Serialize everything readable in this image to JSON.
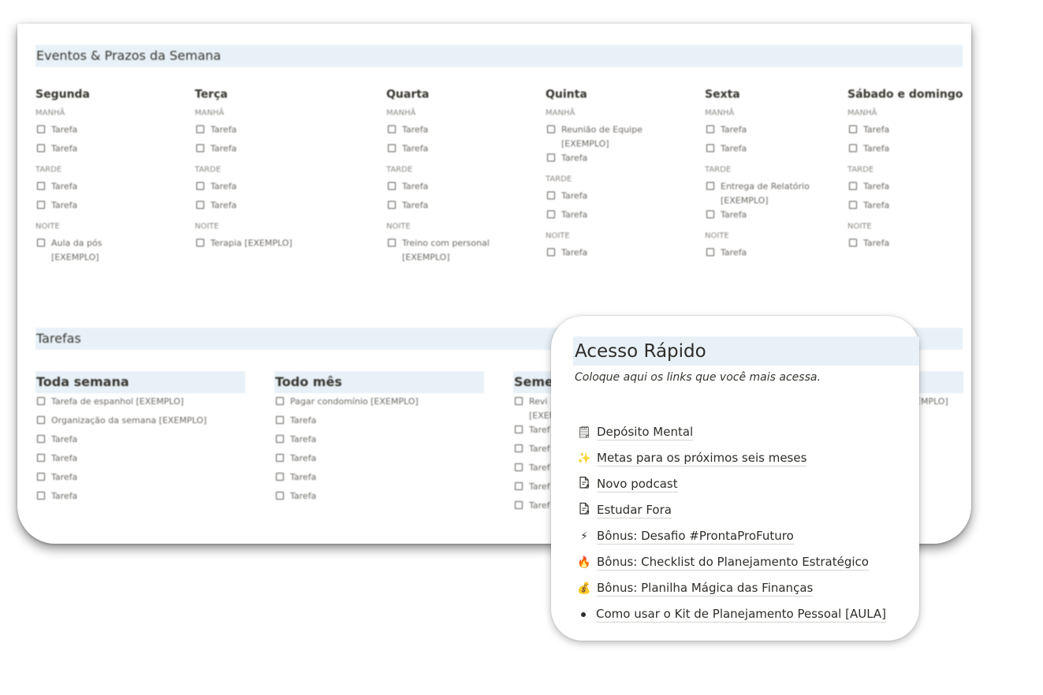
{
  "events": {
    "title": "Eventos & Prazos da Semana",
    "days": [
      {
        "name": "Segunda",
        "periods": [
          {
            "label": "MANHÃ",
            "tasks": [
              "Tarefa",
              "Tarefa"
            ]
          },
          {
            "label": "TARDE",
            "tasks": [
              "Tarefa",
              "Tarefa"
            ]
          },
          {
            "label": "NOITE",
            "tasks": [
              "Aula da pós [EXEMPLO]"
            ]
          }
        ]
      },
      {
        "name": "Terça",
        "periods": [
          {
            "label": "MANHÃ",
            "tasks": [
              "Tarefa",
              "Tarefa"
            ]
          },
          {
            "label": "TARDE",
            "tasks": [
              "Tarefa",
              "Tarefa"
            ]
          },
          {
            "label": "NOITE",
            "tasks": [
              "Terapia [EXEMPLO]"
            ]
          }
        ]
      },
      {
        "name": "Quarta",
        "periods": [
          {
            "label": "MANHÃ",
            "tasks": [
              "Tarefa",
              "Tarefa"
            ]
          },
          {
            "label": "TARDE",
            "tasks": [
              "Tarefa",
              "Tarefa"
            ]
          },
          {
            "label": "NOITE",
            "tasks": [
              "Treino com personal [EXEMPLO]"
            ]
          }
        ]
      },
      {
        "name": "Quinta",
        "periods": [
          {
            "label": "MANHÃ",
            "tasks": [
              "Reunião de Equipe [EXEMPLO]",
              "Tarefa"
            ]
          },
          {
            "label": "TARDE",
            "tasks": [
              "Tarefa",
              "Tarefa"
            ]
          },
          {
            "label": "NOITE",
            "tasks": [
              "Tarefa"
            ]
          }
        ]
      },
      {
        "name": "Sexta",
        "periods": [
          {
            "label": "MANHÃ",
            "tasks": [
              "Tarefa",
              "Tarefa"
            ]
          },
          {
            "label": "TARDE",
            "tasks": [
              "Entrega de Relatório [EXEMPLO]",
              "Tarefa"
            ]
          },
          {
            "label": "NOITE",
            "tasks": [
              "Tarefa"
            ]
          }
        ]
      },
      {
        "name": "Sábado e domingo",
        "periods": [
          {
            "label": "MANHÃ",
            "tasks": [
              "Tarefa",
              "Tarefa"
            ]
          },
          {
            "label": "TARDE",
            "tasks": [
              "Tarefa",
              "Tarefa"
            ]
          },
          {
            "label": "NOITE",
            "tasks": [
              "Tarefa"
            ]
          }
        ]
      }
    ]
  },
  "tarefas": {
    "title": "Tarefas",
    "lists": [
      {
        "name": "Toda semana",
        "tasks": [
          "Tarefa de espanhol [EXEMPLO]",
          "Organização da semana [EXEMPLO]",
          "Tarefa",
          "Tarefa",
          "Tarefa",
          "Tarefa"
        ]
      },
      {
        "name": "Todo mês",
        "tasks": [
          "Pagar condomínio [EXEMPLO]",
          "Tarefa",
          "Tarefa",
          "Tarefa",
          "Tarefa",
          "Tarefa"
        ]
      },
      {
        "name": "Semes",
        "tasks": [
          "Revi [EXEM",
          "Taref",
          "Taref",
          "Taref",
          "Taref",
          "Taref"
        ]
      },
      {
        "name": "",
        "tasks": [
          "EMPLO]"
        ]
      }
    ]
  },
  "quick_access": {
    "title": "Acesso Rápido",
    "subtitle": "Coloque aqui os links que você mais acessa.",
    "links": [
      {
        "icon": "notepad-icon",
        "glyph": "🗒",
        "label": "Depósito Mental"
      },
      {
        "icon": "sparkles-icon",
        "glyph": "✨",
        "label": "Metas para os próximos seis meses"
      },
      {
        "icon": "page-link-icon",
        "glyph": "",
        "label": "Novo podcast"
      },
      {
        "icon": "page-link-icon",
        "glyph": "",
        "label": "Estudar Fora"
      },
      {
        "icon": "lightning-icon",
        "glyph": "⚡",
        "label": "Bônus: Desafio #ProntaProFuturo"
      },
      {
        "icon": "fire-icon",
        "glyph": "🔥",
        "label": "Bônus: Checklist do Planejamento Estratégico"
      },
      {
        "icon": "money-bag-icon",
        "glyph": "💰",
        "label": "Bônus: Planilha Mágica das Finanças"
      },
      {
        "icon": "bullet",
        "glyph": "",
        "label": "Como usar o Kit de Planejamento Pessoal [AULA]"
      }
    ]
  },
  "colors": {
    "header_bg": "#e8f1f8",
    "text": "#37352f"
  }
}
